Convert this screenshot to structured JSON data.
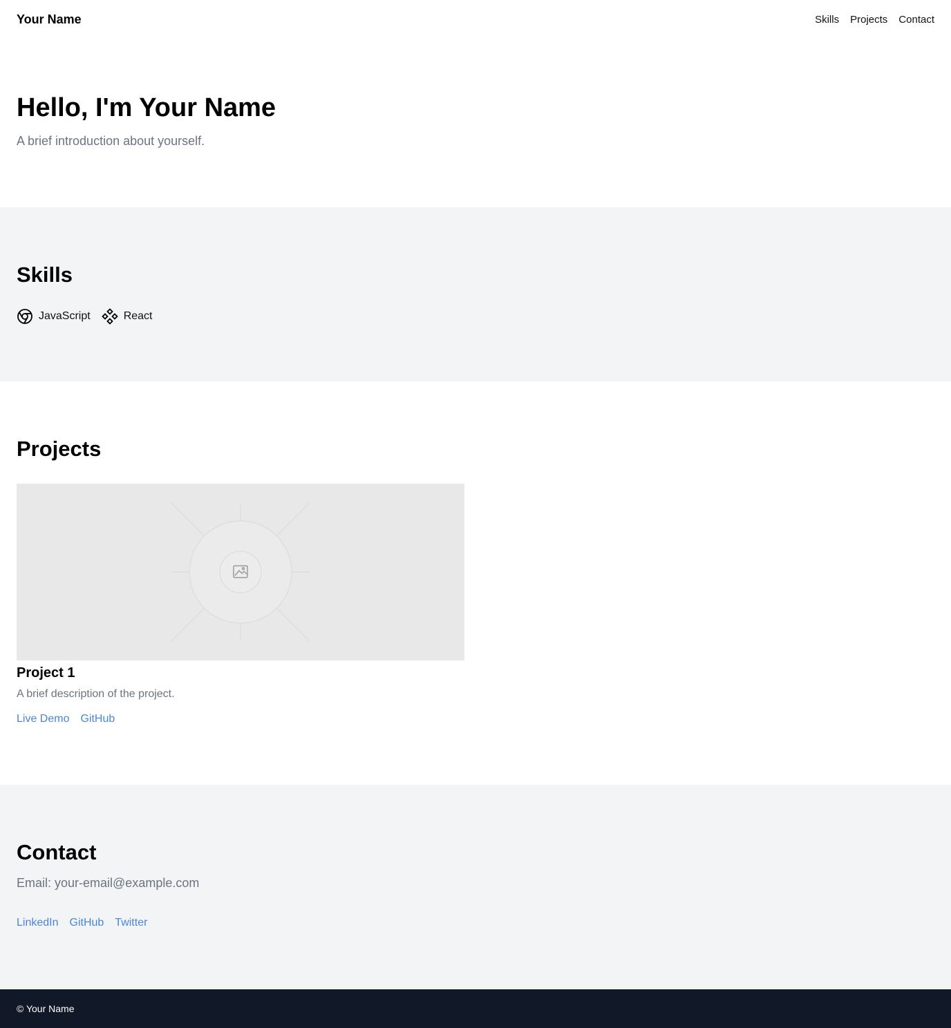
{
  "header": {
    "brand": "Your Name",
    "nav": [
      "Skills",
      "Projects",
      "Contact"
    ]
  },
  "hero": {
    "title": "Hello, I'm Your Name",
    "subtitle": "A brief introduction about yourself."
  },
  "skills": {
    "title": "Skills",
    "items": [
      {
        "label": "JavaScript",
        "icon": "chrome-icon"
      },
      {
        "label": "React",
        "icon": "diamond-grid-icon"
      }
    ]
  },
  "projects": {
    "title": "Projects",
    "items": [
      {
        "title": "Project 1",
        "description": "A brief description of the project.",
        "image_icon": "image-placeholder-icon",
        "links": [
          "Live Demo",
          "GitHub"
        ]
      }
    ]
  },
  "contact": {
    "title": "Contact",
    "email": "Email: your-email@example.com",
    "links": [
      "LinkedIn",
      "GitHub",
      "Twitter"
    ]
  },
  "footer": {
    "text": "© Your Name"
  },
  "colors": {
    "link": "#4a86d4",
    "muted_text": "#6b7280",
    "section_gray": "#f3f4f6",
    "footer_bg": "#111827"
  }
}
